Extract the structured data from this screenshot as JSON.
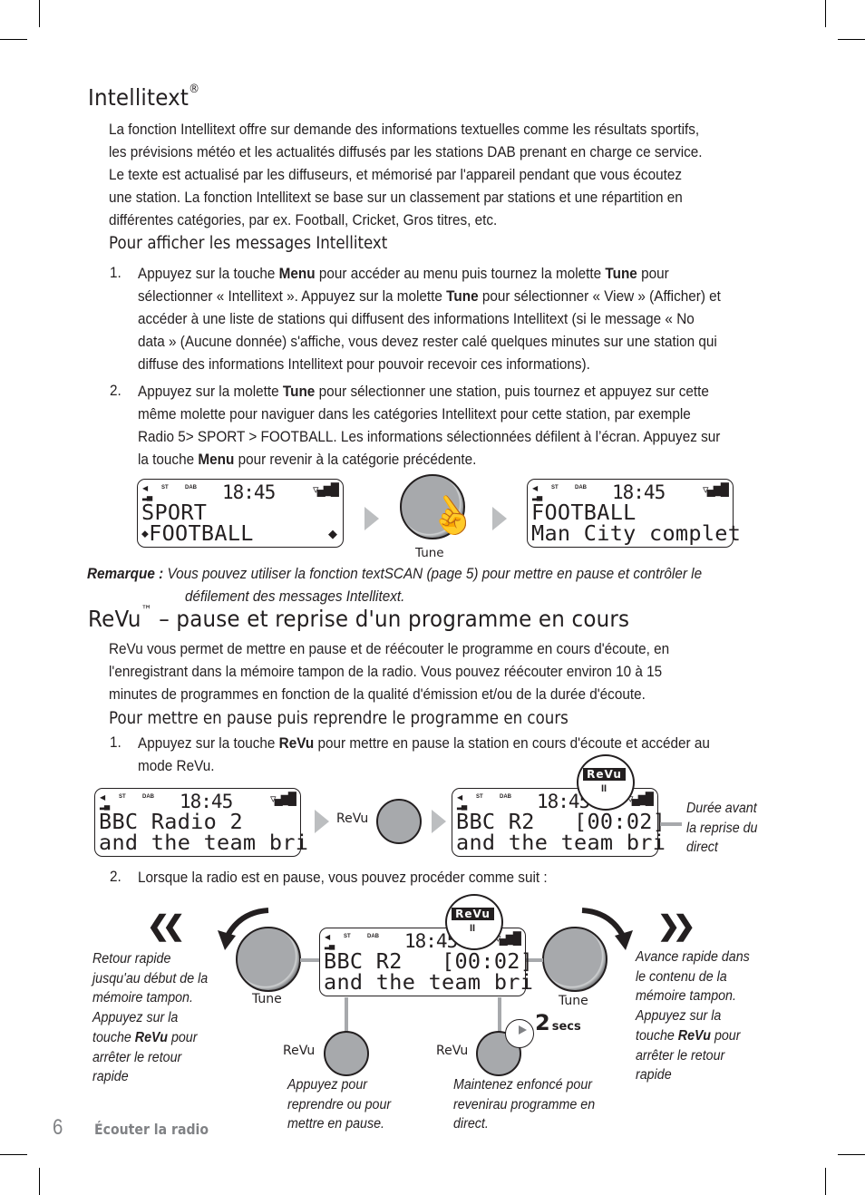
{
  "intellitext": {
    "title": "Intellitext",
    "title_mark": "®",
    "intro_lines": [
      "La fonction Intellitext offre sur demande des informations textuelles comme les résultats sportifs,",
      "les prévisions météo et les actualités diffusés par les stations DAB prenant en charge ce service.",
      "Le texte est actualisé par les diffuseurs, et mémorisé par l'appareil pendant que vous écoutez",
      "une station. La fonction Intellitext se base sur un classement par stations et une répartition en",
      "différentes catégories, par ex. Football, Cricket, Gros titres, etc."
    ],
    "subheading": "Pour afficher les messages Intellitext",
    "steps": [
      {
        "number": "1.",
        "lines": [
          [
            "Appuyez sur la touche ",
            {
              "b": "Menu"
            },
            " pour accéder au menu puis tournez la molette ",
            {
              "b": "Tune"
            },
            " pour"
          ],
          [
            "sélectionner « Intellitext ». Appuyez sur la molette ",
            {
              "b": "Tune"
            },
            " pour sélectionner « View » (Afficher) et"
          ],
          [
            "accéder à une liste de stations qui diffusent des informations Intellitext (si le message « No"
          ],
          [
            "data » (Aucune donnée) s'affiche, vous devez rester calé quelques minutes sur une station qui"
          ],
          [
            "diffuse des informations Intellitext pour pouvoir recevoir ces informations)."
          ]
        ]
      },
      {
        "number": "2.",
        "lines": [
          [
            "Appuyez sur la molette ",
            {
              "b": "Tune"
            },
            " pour sélectionner une station, puis tournez et appuyez sur cette"
          ],
          [
            "même molette pour naviguer dans les catégories Intellitext pour cette station, par exemple"
          ],
          [
            "Radio 5> SPORT > FOOTBALL. Les informations sélectionnées défilent à l’écran. Appuyez sur"
          ],
          [
            "la touche ",
            {
              "b": "Menu"
            },
            " pour revenir à la catégorie précédente."
          ]
        ]
      }
    ],
    "figure": {
      "display_before": {
        "indicators": [
          "ST",
          "DAB"
        ],
        "time": "18:45",
        "line1": "SPORT",
        "line2": "FOOTBALL"
      },
      "knob_label": "Tune",
      "display_after": {
        "indicators": [
          "ST",
          "DAB"
        ],
        "time": "18:45",
        "line1": "FOOTBALL",
        "line2": "Man City complet"
      }
    },
    "note_label": "Remarque :",
    "note_lines": [
      "Vous pouvez utiliser la fonction textSCAN (page 5) pour mettre en pause et contrôler le",
      "défilement des messages Intellitext."
    ]
  },
  "revu": {
    "title": "ReVu",
    "title_mark": "™",
    "title_rest": " – pause et reprise d'un programme en cours",
    "intro_lines": [
      "ReVu vous permet de mettre en pause et de réécouter le programme en cours d'écoute, en",
      "l'enregistrant dans la mémoire tampon de la radio. Vous pouvez réécouter environ 10 à 15",
      "minutes de programmes en fonction de la qualité d'émission et/ou de la durée d'écoute."
    ],
    "subheading": "Pour mettre en pause puis reprendre le programme en cours",
    "step1": {
      "number": "1.",
      "lines": [
        [
          "Appuyez sur la touche ",
          {
            "b": "ReVu"
          },
          " pour mettre en pause la station en cours d'écoute et accéder au"
        ],
        [
          "mode ReVu."
        ]
      ]
    },
    "figure1": {
      "display_before": {
        "indicators": [
          "ST",
          "DAB"
        ],
        "time": "18:45",
        "line1": "BBC Radio 2",
        "line2": "and the team bri"
      },
      "button_label": "ReVu",
      "display_after": {
        "indicators": [
          "ST",
          "DAB"
        ],
        "time": "18:45",
        "line1": "BBC R2   [00:02]",
        "line2": "and the team bri"
      },
      "badge_label": "ReVu",
      "badge_pause": "II",
      "callout_lines": [
        "Durée avant",
        "la reprise du",
        "direct"
      ]
    },
    "step2": {
      "number": "2.",
      "text": "Lorsque la radio est en pause, vous pouvez procéder comme suit :"
    },
    "figure2": {
      "rewind_icon": "«",
      "forward_icon": "»",
      "rewind_caption": [
        [
          "Retour rapide"
        ],
        [
          "jusqu'au début de la"
        ],
        [
          "mémoire tampon."
        ],
        [
          "Appuyez sur la"
        ],
        [
          "touche ",
          {
            "b": "ReVu"
          },
          " pour"
        ],
        [
          "arrêter le retour"
        ],
        [
          "rapide"
        ]
      ],
      "forward_caption": [
        [
          "Avance rapide dans"
        ],
        [
          "le contenu de la"
        ],
        [
          "mémoire tampon."
        ],
        [
          "Appuyez sur la"
        ],
        [
          "touche ",
          {
            "b": "ReVu"
          },
          " pour"
        ],
        [
          "arrêter le retour"
        ],
        [
          "rapide"
        ]
      ],
      "tune_left_label": "Tune",
      "tune_right_label": "Tune",
      "revu_left_label": "ReVu",
      "revu_right_label": "ReVu",
      "display": {
        "indicators": [
          "ST",
          "DAB"
        ],
        "time": "18:45",
        "line1": "BBC R2   [00:02]",
        "line2": "and the team bri"
      },
      "badge_label": "ReVu",
      "badge_pause": "II",
      "hold_number": "2",
      "hold_unit": "secs",
      "press_caption": [
        "Appuyez pour",
        "reprendre ou pour",
        "mettre en pause."
      ],
      "hold_caption": [
        "Maintenez enfoncé pour",
        "revenirau programme en",
        "direct."
      ]
    }
  },
  "footer": {
    "page_number": "6",
    "section": "Écouter la radio"
  }
}
